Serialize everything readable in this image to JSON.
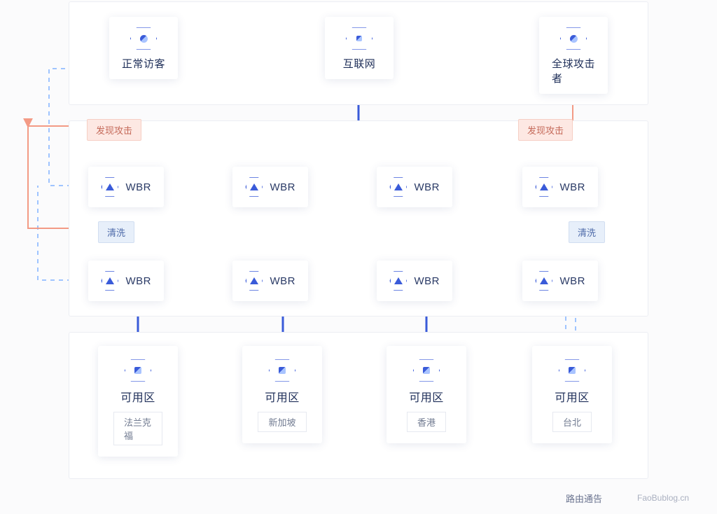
{
  "top": {
    "visitor": "正常访客",
    "internet": "互联网",
    "attacker": "全球攻击者"
  },
  "labels": {
    "discover_attack": "发现攻击",
    "clean": "清洗",
    "wbr": "WBR",
    "available_zone": "可用区"
  },
  "datacenters": [
    {
      "region": "法兰克福"
    },
    {
      "region": "新加坡"
    },
    {
      "region": "香港"
    },
    {
      "region": "台北"
    }
  ],
  "footnote": "路由通告",
  "watermark": "FaoBublog.cn"
}
